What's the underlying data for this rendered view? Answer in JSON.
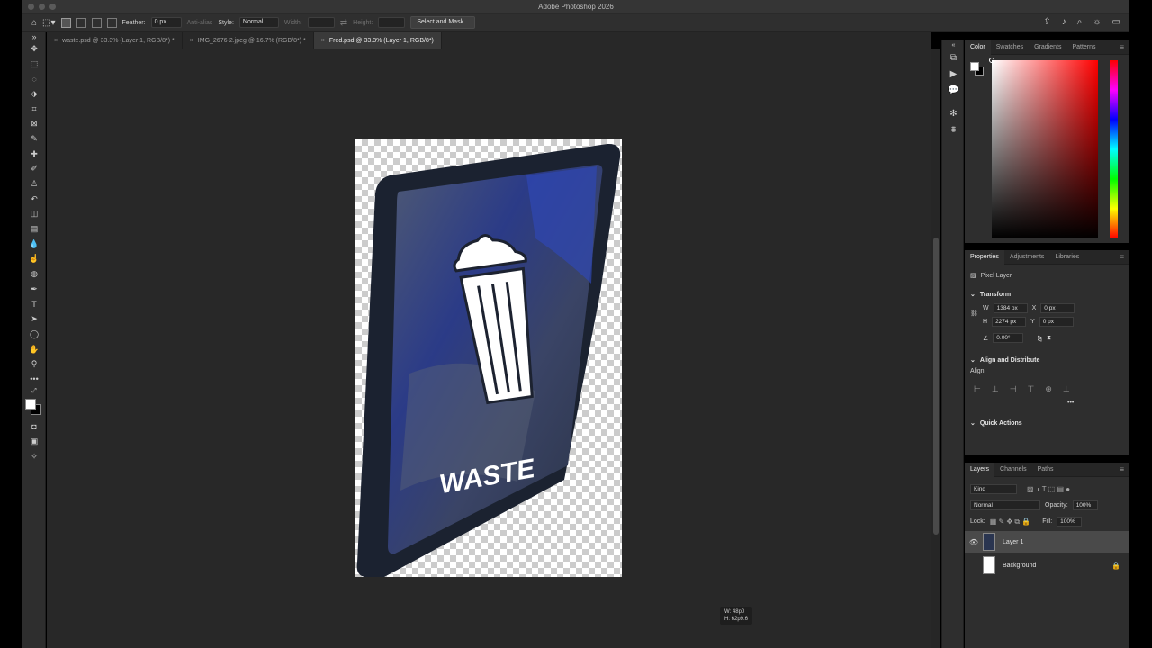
{
  "window": {
    "title": "Adobe Photoshop 2026"
  },
  "options_bar": {
    "feather_label": "Feather:",
    "feather_value": "0 px",
    "anti_alias_label": "Anti-alias",
    "style_label": "Style:",
    "style_value": "Normal",
    "width_label": "Width:",
    "height_label": "Height:",
    "select_mask_label": "Select and Mask..."
  },
  "tabs": [
    {
      "label": "waste.psd @ 33.3% (Layer 1, RGB/8*) *"
    },
    {
      "label": "IMG_2676-2.jpeg @ 16.7% (RGB/8*) *"
    },
    {
      "label": "Fred.psd @ 33.3% (Layer 1, RGB/8*)"
    }
  ],
  "canvas": {
    "sign_text": "WASTE",
    "cursor_readout": {
      "w": "W: 48p0",
      "h": "H: 62p9.6"
    }
  },
  "color_panel": {
    "tabs": [
      "Color",
      "Swatches",
      "Gradients",
      "Patterns"
    ]
  },
  "properties": {
    "tabs": [
      "Properties",
      "Adjustments",
      "Libraries"
    ],
    "layer_type": "Pixel Layer",
    "transform_label": "Transform",
    "w_label": "W",
    "w_value": "1384 px",
    "h_label": "H",
    "h_value": "2274 px",
    "x_label": "X",
    "x_value": "0 px",
    "y_label": "Y",
    "y_value": "0 px",
    "angle_value": "0.00°",
    "align_label": "Align and Distribute",
    "align_sub": "Align:",
    "quick_actions_label": "Quick Actions"
  },
  "layers": {
    "tabs": [
      "Layers",
      "Channels",
      "Paths"
    ],
    "kind_label": "Kind",
    "blend_mode": "Normal",
    "opacity_label": "Opacity:",
    "opacity_value": "100%",
    "lock_label": "Lock:",
    "fill_label": "Fill:",
    "fill_value": "100%",
    "items": [
      {
        "name": "Layer 1"
      },
      {
        "name": "Background"
      }
    ]
  }
}
